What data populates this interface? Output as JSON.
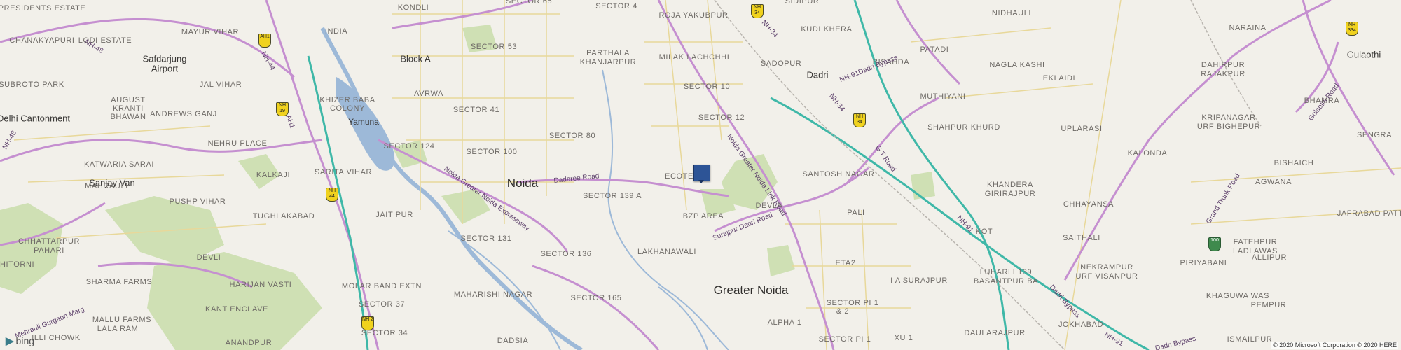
{
  "map": {
    "provider_logo": "bing",
    "copyright": "© 2020 Microsoft Corporation © 2020 HERE",
    "marker_icon": "square-location-marker"
  },
  "place_labels": [
    {
      "text": "PRESIDENTS ESTATE",
      "style": "area"
    },
    {
      "text": "KONDLI",
      "style": "area"
    },
    {
      "text": "SECTOR 65",
      "style": "area"
    },
    {
      "text": "SECTOR 4",
      "style": "area"
    },
    {
      "text": "ROJA YAKUBPUR",
      "style": "area"
    },
    {
      "text": "SIDIPUR",
      "style": "area"
    },
    {
      "text": "NIDHAULI",
      "style": "area"
    },
    {
      "text": "CHANAKYAPURI",
      "style": "area"
    },
    {
      "text": "LODI ESTATE",
      "style": "area"
    },
    {
      "text": "MAYUR VIHAR",
      "style": "area"
    },
    {
      "text": "INDIA",
      "style": "area"
    },
    {
      "text": "KUDI KHERA",
      "style": "area"
    },
    {
      "text": "NARAINA",
      "style": "area"
    },
    {
      "text": "Safdarjung",
      "style": "city"
    },
    {
      "text": "Airport",
      "style": "city"
    },
    {
      "text": "SECTOR 53",
      "style": "area"
    },
    {
      "text": "PATADI",
      "style": "area"
    },
    {
      "text": "Block A",
      "style": "city"
    },
    {
      "text": "PARTHALA",
      "style": "area"
    },
    {
      "text": "KHANJARPUR",
      "style": "area"
    },
    {
      "text": "MILAK LACHCHHI",
      "style": "area"
    },
    {
      "text": "SADOPUR",
      "style": "area"
    },
    {
      "text": "Dadri",
      "style": "city"
    },
    {
      "text": "BISAHDA",
      "style": "area"
    },
    {
      "text": "NAGLA KASHI",
      "style": "area"
    },
    {
      "text": "DAHIRPUR",
      "style": "area"
    },
    {
      "text": "RAJAKPUR",
      "style": "area"
    },
    {
      "text": "SUBROTO PARK",
      "style": "area"
    },
    {
      "text": "JAL VIHAR",
      "style": "area"
    },
    {
      "text": "AVRWA",
      "style": "area"
    },
    {
      "text": "SECTOR 10",
      "style": "area"
    },
    {
      "text": "EKLAIDI",
      "style": "area"
    },
    {
      "text": "BHAMRA",
      "style": "area"
    },
    {
      "text": "AUGUST",
      "style": "area"
    },
    {
      "text": "KRANTI",
      "style": "area"
    },
    {
      "text": "BHAWAN",
      "style": "area"
    },
    {
      "text": "KHIZER BABA",
      "style": "area"
    },
    {
      "text": "COLONY",
      "style": "area"
    },
    {
      "text": "MUTHIYANI",
      "style": "area"
    },
    {
      "text": "Delhi Cantonment",
      "style": "city"
    },
    {
      "text": "ANDREWS GANJ",
      "style": "area"
    },
    {
      "text": "Yamuna",
      "style": "water"
    },
    {
      "text": "SECTOR 41",
      "style": "area"
    },
    {
      "text": "SECTOR 12",
      "style": "area"
    },
    {
      "text": "KRIPANAGAR",
      "style": "area"
    },
    {
      "text": "URF BIGHEPUR",
      "style": "area"
    },
    {
      "text": "NEHRU PLACE",
      "style": "area"
    },
    {
      "text": "SECTOR 124",
      "style": "area"
    },
    {
      "text": "SECTOR 80",
      "style": "area"
    },
    {
      "text": "SHAHPUR KHURD",
      "style": "area"
    },
    {
      "text": "UPLARASI",
      "style": "area"
    },
    {
      "text": "SENGRA",
      "style": "area"
    },
    {
      "text": "SECTOR 100",
      "style": "area"
    },
    {
      "text": "KALONDA",
      "style": "area"
    },
    {
      "text": "KATWARIA SARAI",
      "style": "area"
    },
    {
      "text": "BISHAICH",
      "style": "area"
    },
    {
      "text": "Sanjay Van",
      "style": "city"
    },
    {
      "text": "SARITA VIHAR",
      "style": "area"
    },
    {
      "text": "KALKAJI",
      "style": "area"
    },
    {
      "text": "ECOTECH",
      "style": "area"
    },
    {
      "text": "SANTOSH NAGAR",
      "style": "area"
    },
    {
      "text": "AGWANA",
      "style": "area"
    },
    {
      "text": "Noida",
      "style": "big"
    },
    {
      "text": "KHANDERA",
      "style": "area"
    },
    {
      "text": "GIRIRAJPUR",
      "style": "area"
    },
    {
      "text": "MAHRAULI",
      "style": "area"
    },
    {
      "text": "PUSHP VIHAR",
      "style": "area"
    },
    {
      "text": "SECTOR 139 A",
      "style": "area"
    },
    {
      "text": "TUGHLAKABAD",
      "style": "area"
    },
    {
      "text": "JAIT PUR",
      "style": "area"
    },
    {
      "text": "DEVLA",
      "style": "area"
    },
    {
      "text": "PALI",
      "style": "area"
    },
    {
      "text": "CHHAYANSA",
      "style": "area"
    },
    {
      "text": "JAFRABAD PATTI",
      "style": "area"
    },
    {
      "text": "BZP AREA",
      "style": "area"
    },
    {
      "text": "CHHATTARPUR",
      "style": "area"
    },
    {
      "text": "PAHARI",
      "style": "area"
    },
    {
      "text": "SECTOR 131",
      "style": "area"
    },
    {
      "text": "KOT",
      "style": "area"
    },
    {
      "text": "SAITHALI",
      "style": "area"
    },
    {
      "text": "FATEHPUR",
      "style": "area"
    },
    {
      "text": "LADLAWAS",
      "style": "area"
    },
    {
      "text": "LAKHANAWALI",
      "style": "area"
    },
    {
      "text": "GHITORNI",
      "style": "area"
    },
    {
      "text": "DEVLI",
      "style": "area"
    },
    {
      "text": "SECTOR 136",
      "style": "area"
    },
    {
      "text": "ALLIPUR",
      "style": "area"
    },
    {
      "text": "SHARMA FARMS",
      "style": "area"
    },
    {
      "text": "HARIJAN VASTI",
      "style": "area"
    },
    {
      "text": "MOLAR BAND EXTN",
      "style": "area"
    },
    {
      "text": "ETA2",
      "style": "area"
    },
    {
      "text": "NEKRAMPUR",
      "style": "area"
    },
    {
      "text": "URF VISANPUR",
      "style": "area"
    },
    {
      "text": "PIRIYABANI",
      "style": "area"
    },
    {
      "text": "Greater Noida",
      "style": "big"
    },
    {
      "text": "I A SURAJPUR",
      "style": "area"
    },
    {
      "text": "LUHARLI 139",
      "style": "area"
    },
    {
      "text": "BASANTPUR BA",
      "style": "area"
    },
    {
      "text": "MAHARISHI NAGAR",
      "style": "area"
    },
    {
      "text": "KHAGUWA WAS",
      "style": "area"
    },
    {
      "text": "SECTOR 165",
      "style": "area"
    },
    {
      "text": "KANT ENCLAVE",
      "style": "area"
    },
    {
      "text": "MALLU FARMS",
      "style": "area"
    },
    {
      "text": "SECTOR 37",
      "style": "area"
    },
    {
      "text": "SECTOR PI 1",
      "style": "area"
    },
    {
      "text": "& 2",
      "style": "area"
    },
    {
      "text": "PEMPUR",
      "style": "area"
    },
    {
      "text": "JOKHABAD",
      "style": "area"
    },
    {
      "text": "ALPHA 1",
      "style": "area"
    },
    {
      "text": "LALA RAM",
      "style": "area"
    },
    {
      "text": "ILLI CHOWK",
      "style": "area"
    },
    {
      "text": "SECTOR 34",
      "style": "area"
    },
    {
      "text": "DAULARAJPUR",
      "style": "area"
    },
    {
      "text": "XU 1",
      "style": "area"
    },
    {
      "text": "ISMAILPUR",
      "style": "area"
    },
    {
      "text": "ANANDPUR",
      "style": "area"
    },
    {
      "text": "DADSIA",
      "style": "area"
    },
    {
      "text": "SECTOR PI 1",
      "style": "area"
    },
    {
      "text": "Gulaothi",
      "style": "city"
    }
  ],
  "road_labels": [
    {
      "text": "NH-48"
    },
    {
      "text": "NH-44"
    },
    {
      "text": "NH-34"
    },
    {
      "text": "NH-91Dadri Bypass"
    },
    {
      "text": "NH-34"
    },
    {
      "text": "G T Road"
    },
    {
      "text": "Noida Greater Noida Link Road"
    },
    {
      "text": "Dadaree Road"
    },
    {
      "text": "Noida Greater Noida Expressway"
    },
    {
      "text": "Surajpur Dadri Road"
    },
    {
      "text": "NH-91"
    },
    {
      "text": "Dadri Bypass"
    },
    {
      "text": "Grand Trunk Road"
    },
    {
      "text": "Gulaothi Road"
    },
    {
      "text": "NH-91"
    },
    {
      "text": "Dadri Bypass"
    },
    {
      "text": "Mehrauli Gurgaon Marg"
    },
    {
      "text": "AH1"
    },
    {
      "text": "NH-48"
    }
  ],
  "route_shields": [
    {
      "label": "NH 34",
      "color": "yellow"
    },
    {
      "label": "AH1",
      "color": "yellow"
    },
    {
      "label": "NH 19",
      "color": "yellow"
    },
    {
      "label": "NH 34",
      "color": "yellow"
    },
    {
      "label": "NH 44",
      "color": "yellow"
    },
    {
      "label": "NH 2",
      "color": "yellow"
    },
    {
      "label": "NH 334",
      "color": "yellow"
    },
    {
      "label": "100",
      "color": "green"
    }
  ]
}
